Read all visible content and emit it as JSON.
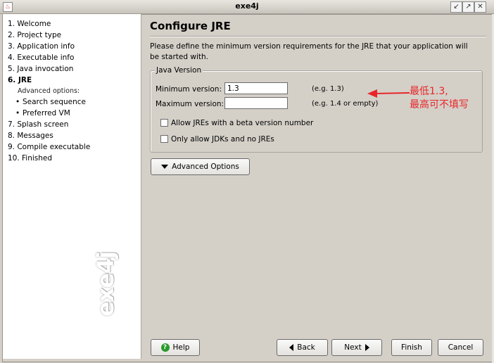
{
  "window": {
    "title": "exe4j"
  },
  "steps": [
    {
      "label": "1. Welcome"
    },
    {
      "label": "2. Project type"
    },
    {
      "label": "3. Application info"
    },
    {
      "label": "4. Executable info"
    },
    {
      "label": "5. Java invocation"
    },
    {
      "label": "6. JRE"
    },
    {
      "label": "7. Splash screen"
    },
    {
      "label": "8. Messages"
    },
    {
      "label": "9. Compile executable"
    },
    {
      "label": "10. Finished"
    }
  ],
  "advanced": {
    "heading": "Advanced options:",
    "items": [
      {
        "label": "Search sequence"
      },
      {
        "label": "Preferred VM"
      }
    ]
  },
  "watermark": "exe4j",
  "page": {
    "title": "Configure JRE",
    "description": "Please define the minimum version requirements for the JRE that your application will be started with."
  },
  "java_version": {
    "group_title": "Java Version",
    "min_label": "Minimum version:",
    "min_value": "1.3",
    "min_hint": "(e.g. 1.3)",
    "max_label": "Maximum version:",
    "max_value": "",
    "max_hint": "(e.g. 1.4 or empty)",
    "beta_label": "Allow JREs with a beta version number",
    "beta_checked": false,
    "jdk_label": "Only allow JDKs and no JREs",
    "jdk_checked": false
  },
  "advanced_button": "Advanced Options",
  "buttons": {
    "help": "Help",
    "back": "Back",
    "next": "Next",
    "finish": "Finish",
    "cancel": "Cancel"
  },
  "annotation": {
    "line1": "最低1.3,",
    "line2": "最高可不填写",
    "color": "#e8262a"
  }
}
